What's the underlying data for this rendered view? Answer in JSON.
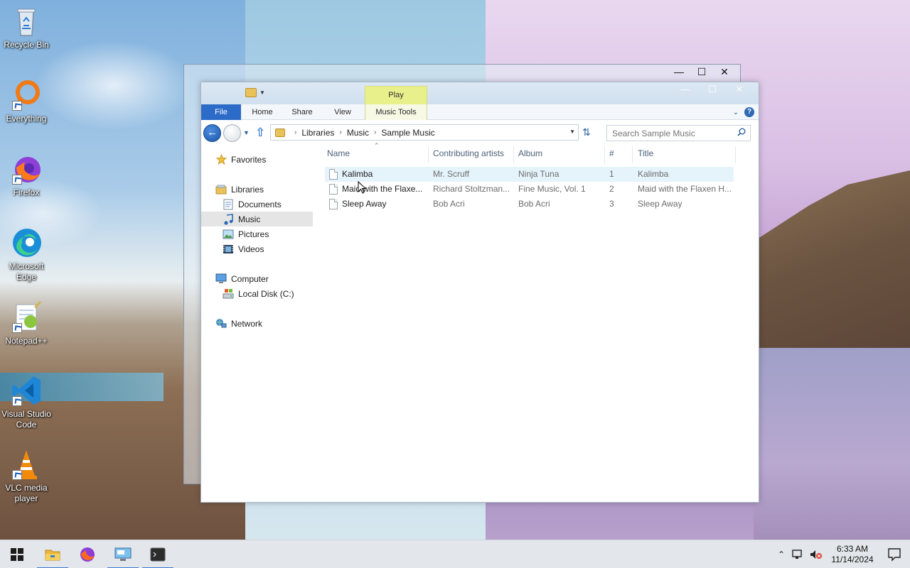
{
  "desktop": {
    "icons": [
      {
        "label": "Recycle Bin",
        "icon": "recycle-bin-icon"
      },
      {
        "label": "Everything",
        "icon": "everything-search-icon"
      },
      {
        "label": "Firefox",
        "icon": "firefox-icon"
      },
      {
        "label": "Microsoft Edge",
        "icon": "edge-icon"
      },
      {
        "label": "Notepad++",
        "icon": "notepadpp-icon"
      },
      {
        "label": "Visual Studio Code",
        "icon": "vscode-icon"
      },
      {
        "label": "VLC media player",
        "icon": "vlc-icon"
      }
    ]
  },
  "window": {
    "contextual_tab": "Play",
    "ribbon_tabs": [
      "File",
      "Home",
      "Share",
      "View",
      "Music Tools"
    ],
    "address": {
      "segments": [
        "Libraries",
        "Music",
        "Sample Music"
      ]
    },
    "search": {
      "placeholder": "Search Sample Music"
    },
    "nav_pane": {
      "favorites": "Favorites",
      "libraries": "Libraries",
      "documents": "Documents",
      "music": "Music",
      "pictures": "Pictures",
      "videos": "Videos",
      "computer": "Computer",
      "local_disk": "Local Disk (C:)",
      "network": "Network"
    },
    "columns": [
      "Name",
      "Contributing artists",
      "Album",
      "#",
      "Title"
    ],
    "files": [
      {
        "name": "Kalimba",
        "artist": "Mr. Scruff",
        "album": "Ninja Tuna",
        "track": "1",
        "title": "Kalimba"
      },
      {
        "name": "Maid with the Flaxe...",
        "artist": "Richard Stoltzman...",
        "album": "Fine Music, Vol. 1",
        "track": "2",
        "title": "Maid with the Flaxen H..."
      },
      {
        "name": "Sleep Away",
        "artist": "Bob Acri",
        "album": "Bob Acri",
        "track": "3",
        "title": "Sleep Away"
      }
    ]
  },
  "taskbar": {
    "apps": [
      "start-icon",
      "file-explorer-icon",
      "firefox-icon",
      "remote-desktop-icon",
      "terminal-icon"
    ],
    "clock": {
      "time": "6:33 AM",
      "date": "11/14/2024"
    }
  },
  "colors": {
    "accent": "#2c6bc7",
    "play_tab": "#e8f08c",
    "hover_row": "#e5f3fb",
    "selected_nav": "#e5e5e5"
  }
}
